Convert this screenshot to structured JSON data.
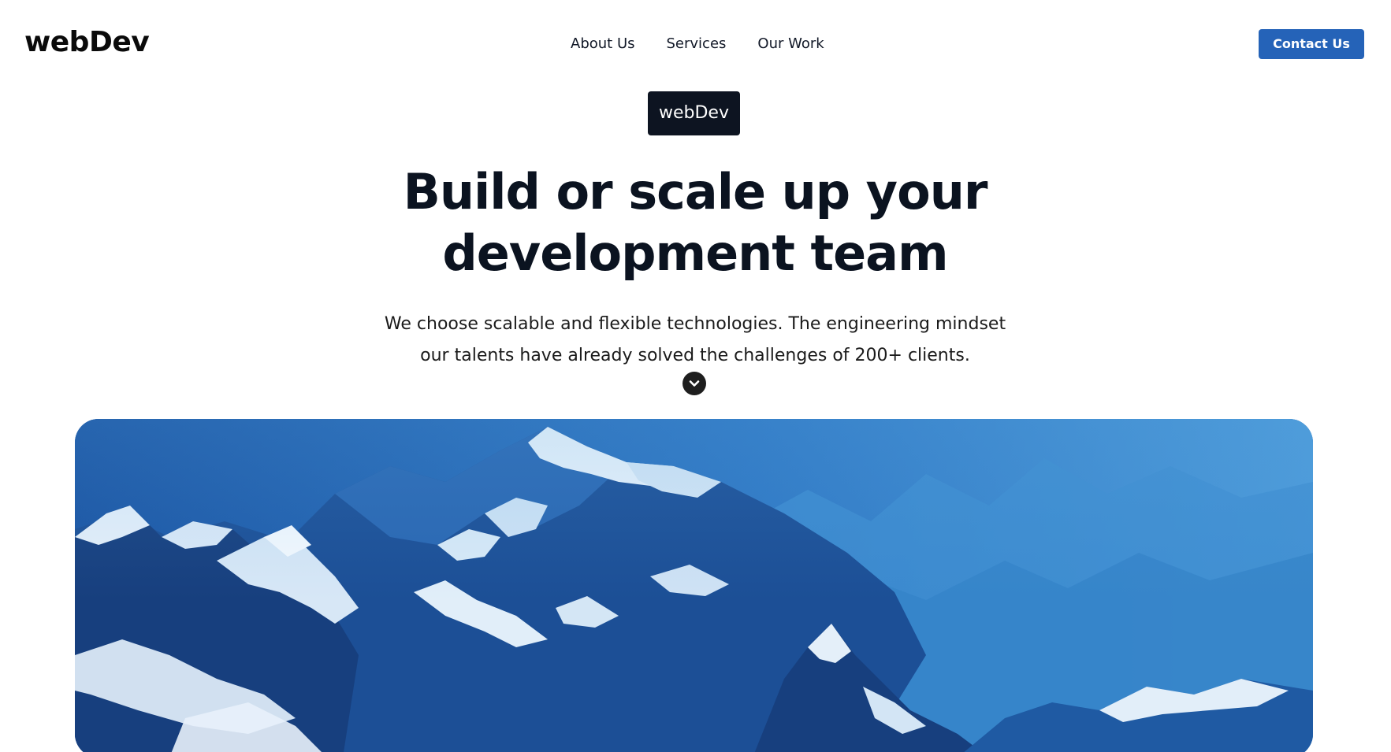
{
  "nav": {
    "brand": "webDev",
    "links": [
      "About Us",
      "Services",
      "Our Work"
    ],
    "contact_label": "Contact Us"
  },
  "hero": {
    "badge": "webDev",
    "headline_line1": "Build or scale up your",
    "headline_line2": "development team",
    "subtext_line1": "We choose scalable and flexible technologies. The engineering mindset",
    "subtext_line2": "our talents have already solved the challenges of 200+ clients.",
    "scroll_icon": "chevron-down-icon",
    "image_subject": "mountains"
  },
  "colors": {
    "accent": "#2563b8",
    "badge_bg": "#0d1421",
    "text_dark": "#0b1320",
    "sky_blue": "#3a86cf"
  }
}
